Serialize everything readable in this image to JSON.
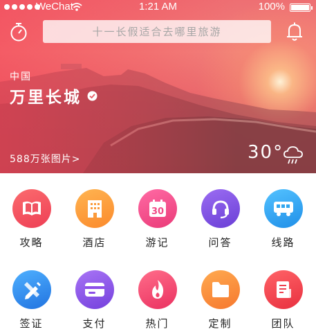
{
  "status_bar": {
    "carrier": "WeChat",
    "time": "1:21 AM",
    "battery": "100%"
  },
  "search": {
    "placeholder": "十一长假适合去哪里旅游"
  },
  "destination": {
    "country": "中国",
    "name": "万里长城",
    "photo_count": "588万张图片>",
    "temperature": "30°"
  },
  "categories": [
    {
      "label": "攻略",
      "icon": "book-icon",
      "color": "#f2525e"
    },
    {
      "label": "酒店",
      "icon": "building-icon",
      "color": "#fb9a3a"
    },
    {
      "label": "游记",
      "icon": "calendar-icon",
      "color": "#f14a86",
      "badge": "30"
    },
    {
      "label": "问答",
      "icon": "headset-icon",
      "color": "#7b4fe0"
    },
    {
      "label": "线路",
      "icon": "bus-icon",
      "color": "#2fa6f0"
    },
    {
      "label": "签证",
      "icon": "pencil-ruler-icon",
      "color": "#2f8ee6"
    },
    {
      "label": "支付",
      "icon": "card-icon",
      "color": "#8c4fe8"
    },
    {
      "label": "热门",
      "icon": "flame-icon",
      "color": "#f2486e"
    },
    {
      "label": "定制",
      "icon": "folder-icon",
      "color": "#f98a3c"
    },
    {
      "label": "团队",
      "icon": "document-icon",
      "color": "#ef3f4e"
    }
  ]
}
